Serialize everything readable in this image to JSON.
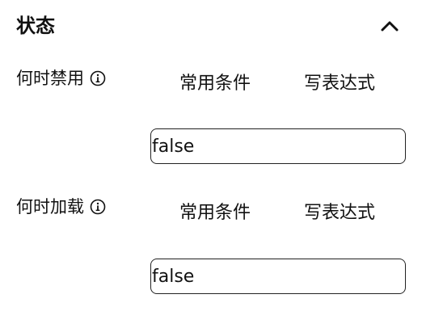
{
  "section": {
    "title": "状态",
    "toggle_icon": "chevron-up-icon"
  },
  "rows": [
    {
      "label": "何时禁用",
      "info_icon": "info-icon",
      "tabs": [
        "常用条件",
        "写表达式"
      ],
      "value": "false"
    },
    {
      "label": "何时加载",
      "info_icon": "info-icon",
      "tabs": [
        "常用条件",
        "写表达式"
      ],
      "value": "false"
    }
  ]
}
